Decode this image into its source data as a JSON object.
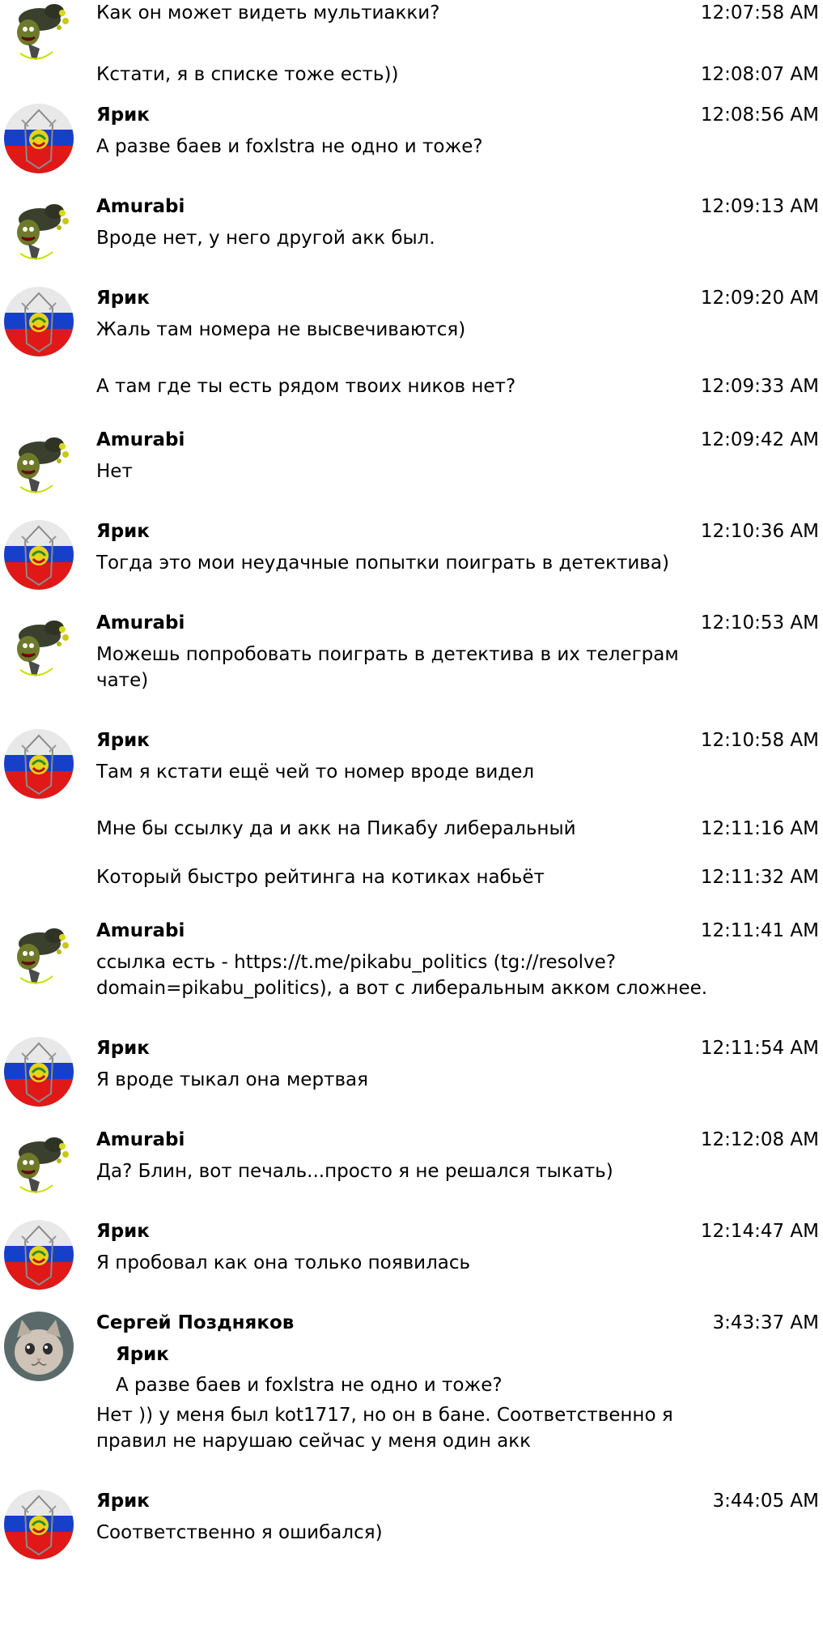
{
  "messages": [
    {
      "id": "m1",
      "author": "",
      "avatar": "goblin",
      "text": "Как он может видеть мультиакки?",
      "time": "12:07:58 AM"
    },
    {
      "id": "m2",
      "author": "",
      "avatar": "",
      "text": "Кстати, я в списке тоже есть))",
      "time": "12:08:07 AM"
    },
    {
      "id": "m3",
      "author": "Ярик",
      "avatar": "flag",
      "text": "А разве баев и foxlstra не одно и тоже?",
      "time": "12:08:56 AM"
    },
    {
      "id": "m4",
      "author": "Amurabi",
      "avatar": "goblin",
      "text": "Вроде нет, у него другой акк был.",
      "time": "12:09:13 AM"
    },
    {
      "id": "m5",
      "author": "Ярик",
      "avatar": "flag",
      "text": "Жаль там номера не высвечиваются)",
      "time": "12:09:20 AM"
    },
    {
      "id": "m6",
      "author": "",
      "avatar": "",
      "text": "А там где ты есть рядом твоих ников нет?",
      "time": "12:09:33 AM"
    },
    {
      "id": "m7",
      "author": "Amurabi",
      "avatar": "goblin",
      "text": "Нет",
      "time": "12:09:42 AM"
    },
    {
      "id": "m8",
      "author": "Ярик",
      "avatar": "flag",
      "text": "Тогда это мои неудачные попытки поиграть в детектива)",
      "time": "12:10:36 AM"
    },
    {
      "id": "m9",
      "author": "Amurabi",
      "avatar": "goblin",
      "text": "Можешь попробовать поиграть в детектива в их телеграм чате)",
      "time": "12:10:53 AM"
    },
    {
      "id": "m10",
      "author": "Ярик",
      "avatar": "flag",
      "text": "Там я кстати ещё чей то номер вроде видел",
      "time": "12:10:58 AM"
    },
    {
      "id": "m11",
      "author": "",
      "avatar": "",
      "text": "Мне бы ссылку да и акк на Пикабу либеральный",
      "time": "12:11:16 AM"
    },
    {
      "id": "m12",
      "author": "",
      "avatar": "",
      "text": "Который быстро рейтинга на котиках набьёт",
      "time": "12:11:32 AM"
    },
    {
      "id": "m13",
      "author": "Amurabi",
      "avatar": "goblin",
      "text": "ссылка есть - https://t.me/pikabu_politics (tg://resolve?domain=pikabu_politics), а вот с либеральным акком сложнее.",
      "time": "12:11:41 AM"
    },
    {
      "id": "m14",
      "author": "Ярик",
      "avatar": "flag",
      "text": "Я вроде тыкал она мертвая",
      "time": "12:11:54 AM"
    },
    {
      "id": "m15",
      "author": "Amurabi",
      "avatar": "goblin",
      "text": "Да? Блин, вот печаль...просто я не решался тыкать)",
      "time": "12:12:08 AM"
    },
    {
      "id": "m16",
      "author": "Ярик",
      "avatar": "flag",
      "text": "Я пробовал как она только появилась",
      "time": "12:14:47 AM"
    },
    {
      "id": "m17",
      "author": "Сергей Поздняков",
      "avatar": "cat",
      "text": "Нет )) у меня был kot1717, но он в бане. Соответственно я правил не нарушаю сейчас у меня один акк",
      "time": "3:43:37 AM",
      "quote": {
        "author": "Ярик",
        "text": "А разве баев и foxlstra не одно и тоже?"
      }
    },
    {
      "id": "m18",
      "author": "Ярик",
      "avatar": "flag",
      "text": "Соответственно я ошибался)",
      "time": "3:44:05 AM"
    }
  ]
}
